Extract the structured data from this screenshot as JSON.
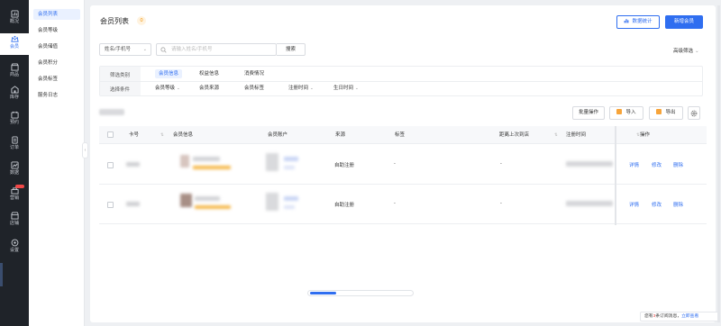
{
  "nav": {
    "items": [
      {
        "label": "概况",
        "icon": "overview-icon"
      },
      {
        "label": "会员",
        "icon": "member-icon"
      },
      {
        "label": "商品",
        "icon": "goods-icon"
      },
      {
        "label": "库存",
        "icon": "inventory-icon"
      },
      {
        "label": "预约",
        "icon": "booking-icon"
      },
      {
        "label": "订单",
        "icon": "order-icon"
      },
      {
        "label": "数据",
        "icon": "data-icon"
      },
      {
        "label": "营销",
        "icon": "marketing-icon"
      },
      {
        "label": "店铺",
        "icon": "store-icon"
      },
      {
        "label": "设置",
        "icon": "settings-icon"
      }
    ],
    "active_color": "#2f6ef0"
  },
  "subnav": {
    "items": [
      "会员列表",
      "会员等级",
      "会员储值",
      "会员积分",
      "会员标签",
      "服务日志"
    ]
  },
  "header": {
    "title": "会员列表",
    "badge": "0",
    "stats_button": "数据统计",
    "add_button": "新增会员"
  },
  "search": {
    "select_value": "姓名/手机号",
    "placeholder": "请输入姓名/手机号",
    "button": "搜索",
    "advanced": "高级筛选"
  },
  "filter": {
    "row1_label": "筛选类别",
    "row1_options": [
      "会员信息",
      "权益信息",
      "消费情况"
    ],
    "row2_label": "选择条件",
    "row2_options": [
      "会员等级",
      "会员来源",
      "会员标签",
      "注册时间",
      "生日时间"
    ]
  },
  "toolbar": {
    "batch": "批量操作",
    "import": "导入",
    "export": "导出"
  },
  "table": {
    "columns": [
      "卡号",
      "会员信息",
      "会员账户",
      "来源",
      "标签",
      "距离上次到店",
      "注册时间",
      "操作"
    ],
    "rows": [
      {
        "source": "自助注册",
        "tag": "-",
        "last_visit": "-",
        "actions": [
          "详情",
          "修改",
          "删除"
        ]
      },
      {
        "source": "自助注册",
        "tag": "-",
        "last_visit": "-",
        "actions": [
          "详情",
          "修改",
          "删除"
        ]
      }
    ]
  },
  "progress": {
    "value": 0.26
  },
  "notice": {
    "prefix": "您有",
    "count": "3",
    "middle": "条订阅消息，",
    "link": "立即查看"
  }
}
